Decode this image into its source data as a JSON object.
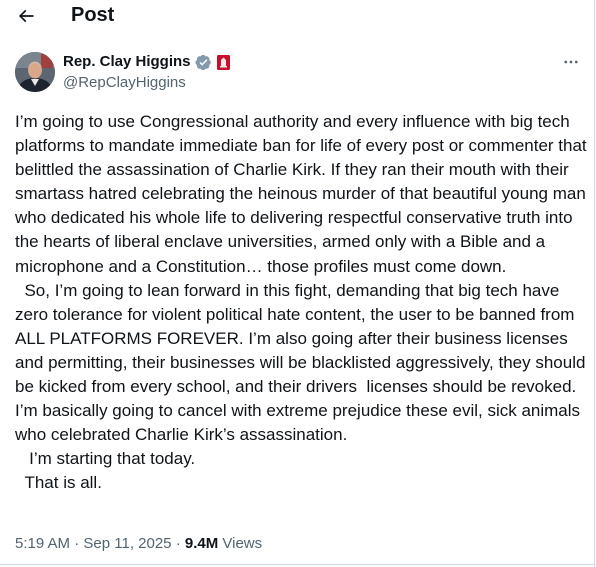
{
  "header": {
    "title": "Post",
    "back_icon": "arrow-left-icon"
  },
  "author": {
    "display_name": "Rep. Clay Higgins",
    "handle": "@RepClayHiggins",
    "verified_icon": "verified-badge-icon",
    "verified_color": "#829aab",
    "affiliation_icon": "us-government-affiliation-icon",
    "affiliation_color": "#c8102e"
  },
  "more_icon": "more-options-icon",
  "tweet": {
    "text": "I’m going to use Congressional authority and every influence with big tech platforms to mandate immediate ban for life of every post or commenter that belittled the assassination of Charlie Kirk. If they ran their mouth with their smartass hatred celebrating the heinous murder of that beautiful young man who dedicated his whole life to delivering respectful conservative truth into the hearts of liberal enclave universities, armed only with a Bible and a microphone and a Constitution… those profiles must come down.\n  So, I’m going to lean forward in this fight, demanding that big tech have zero tolerance for violent political hate content, the user to be banned from ALL PLATFORMS FOREVER. I’m also going after their business licenses and permitting, their businesses will be blacklisted aggressively, they should be kicked from every school, and their drivers  licenses should be revoked. I’m basically going to cancel with extreme prejudice these evil, sick animals who celebrated Charlie Kirk’s assassination.\n   I’m starting that today.\n  That is all."
  },
  "meta": {
    "time": "5:19 AM",
    "separator": " · ",
    "date": "Sep 11, 2025",
    "views_count": "9.4M",
    "views_label": " Views"
  },
  "colors": {
    "text_primary": "#0f1419",
    "text_secondary": "#536471",
    "border": "#cfd9de"
  }
}
